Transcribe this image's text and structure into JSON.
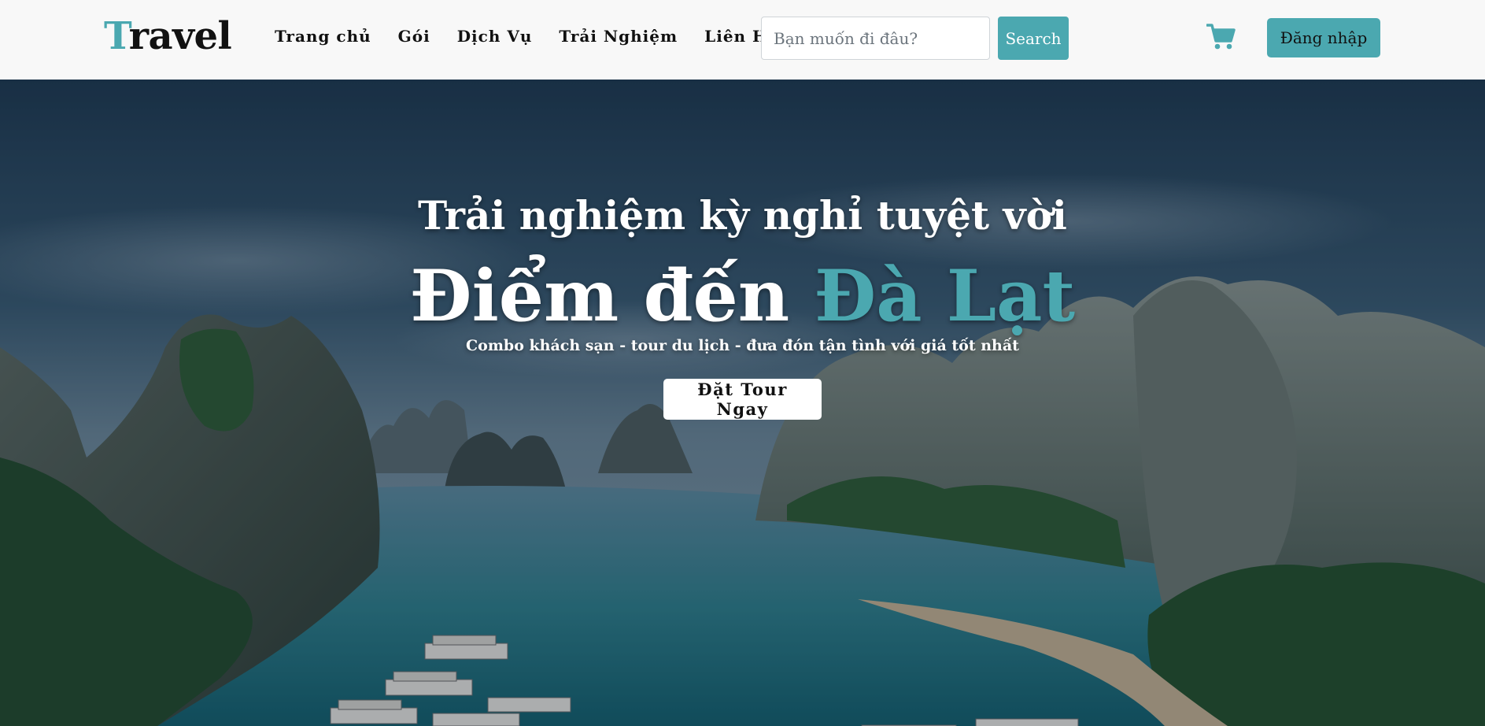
{
  "brand": {
    "logo_first_letter": "T",
    "logo_rest": "ravel",
    "accent_color": "#4ba8b0"
  },
  "nav": {
    "links": [
      {
        "label": "Trang chủ"
      },
      {
        "label": "Gói"
      },
      {
        "label": "Dịch Vụ"
      },
      {
        "label": "Trải Nghiệm"
      },
      {
        "label": "Liên Hệ"
      }
    ]
  },
  "search": {
    "placeholder": "Bạn muốn đi đâu?",
    "value": "",
    "button_label": "Search"
  },
  "cart": {
    "icon": "shopping-cart-icon"
  },
  "auth": {
    "login_label": "Đăng nhập"
  },
  "hero": {
    "tagline": "Trải nghiệm kỳ nghỉ tuyệt vời",
    "headline_prefix": "Điểm đến",
    "headline_destination": "Đà Lạt",
    "subtitle": "Combo khách sạn - tour du lịch - đưa đón tận tình với giá tốt nhất",
    "cta_label": "Đặt Tour Ngay"
  }
}
